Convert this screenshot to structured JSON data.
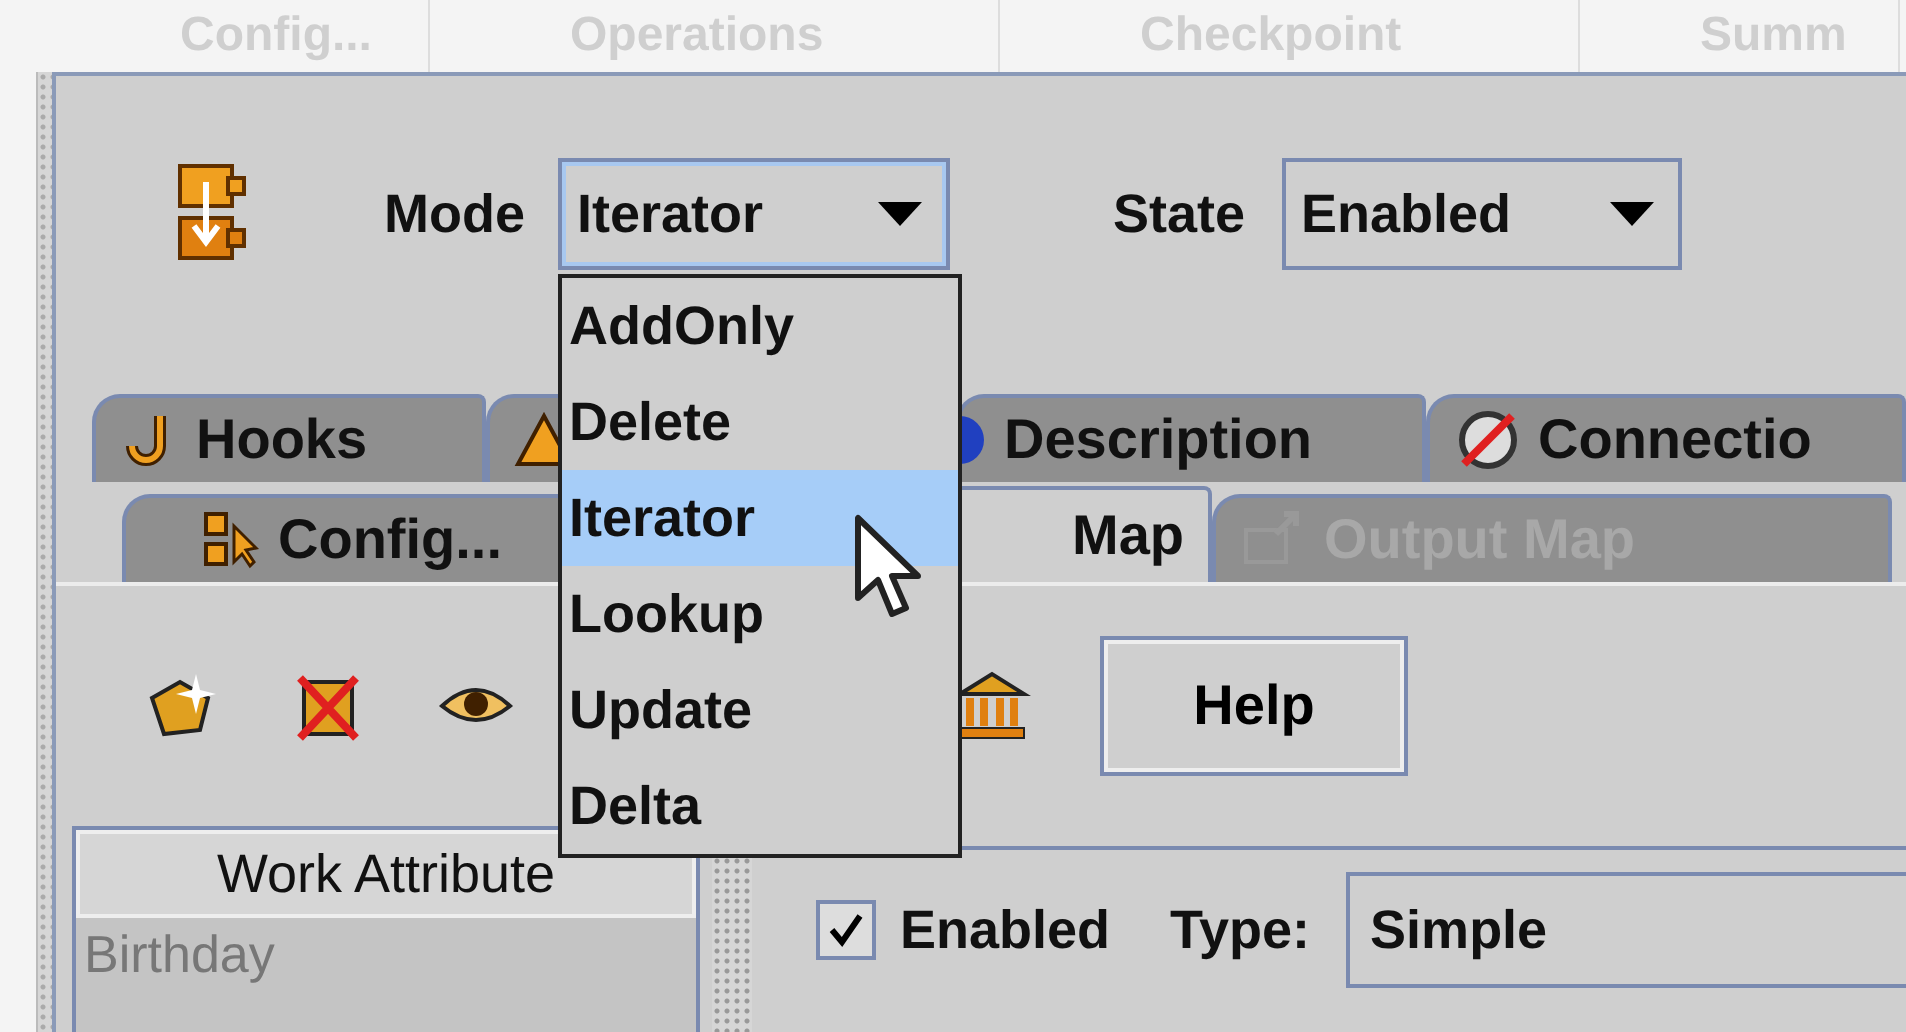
{
  "top_tabs": [
    {
      "label": "Config..."
    },
    {
      "label": "Operations"
    },
    {
      "label": "Checkpoint"
    },
    {
      "label": "Summ"
    }
  ],
  "mode": {
    "label": "Mode",
    "value": "Iterator",
    "expanded": true,
    "options": [
      {
        "label": "AddOnly",
        "selected": false
      },
      {
        "label": "Delete",
        "selected": false
      },
      {
        "label": "Iterator",
        "selected": true
      },
      {
        "label": "Lookup",
        "selected": false
      },
      {
        "label": "Update",
        "selected": false
      },
      {
        "label": "Delta",
        "selected": false
      }
    ]
  },
  "state": {
    "label": "State",
    "value": "Enabled"
  },
  "tabs_row1": [
    {
      "label": "Hooks",
      "selected": false
    },
    {
      "selected": false
    },
    {
      "label": "Description",
      "selected": false
    },
    {
      "label": "Connectio",
      "selected": false
    }
  ],
  "tabs_row2": [
    {
      "label": "Config...",
      "selected": false,
      "disabled": false
    },
    {
      "label": "Map",
      "selected": true,
      "disabled": false
    },
    {
      "label": "Output Map",
      "selected": false,
      "disabled": true
    }
  ],
  "help_button": "Help",
  "attribute_table": {
    "header": "Work Attribute",
    "rows": [
      "Birthday"
    ]
  },
  "enabled": {
    "label": "Enabled",
    "checked": true
  },
  "type": {
    "label": "Type:",
    "value": "Simple"
  }
}
